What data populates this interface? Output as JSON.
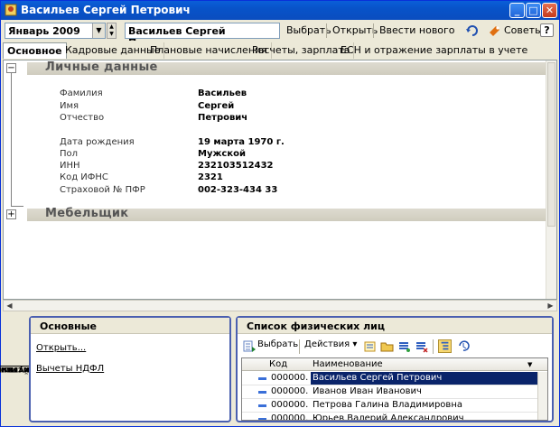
{
  "window": {
    "title": "Васильев Сергей Петрович"
  },
  "toolbar": {
    "period_value": "Январь 2009",
    "person_value": "Васильев Сергей Петрович",
    "select_label": "Выбрать",
    "open_label": "Открыть",
    "enter_new_label": "Ввести нового",
    "tips_label": "Советы",
    "help_label": "?"
  },
  "tabs": [
    {
      "label": "Основное",
      "active": true
    },
    {
      "label": "Кадровые данные"
    },
    {
      "label": "Плановые начисления"
    },
    {
      "label": "Расчеты, зарплата"
    },
    {
      "label": "ЕСН и отражение зарплаты в учете"
    }
  ],
  "personal": {
    "section_title": "Личные данные",
    "expander": "−",
    "fields": [
      {
        "label": "Фамилия",
        "value": "Васильев"
      },
      {
        "label": "Имя",
        "value": "Сергей"
      },
      {
        "label": "Отчество",
        "value": "Петрович"
      },
      {
        "label": "Дата рождения",
        "value": "19 марта 1970 г."
      },
      {
        "label": "Пол",
        "value": "Мужской"
      },
      {
        "label": "ИНН",
        "value": "232103512432"
      },
      {
        "label": "Код ИФНС",
        "value": "2321"
      },
      {
        "label": "Страховой № ПФР",
        "value": "002-323-434 33"
      }
    ]
  },
  "position": {
    "section_title": "Мебельщик",
    "expander": "+"
  },
  "actions": {
    "side_label_line1": "Действия и",
    "side_label_line2": "документы",
    "main_panel": {
      "title": "Основные",
      "links": [
        "Открыть...",
        "Вычеты НДФЛ"
      ]
    },
    "list_panel": {
      "title": "Список физических лиц",
      "select_label": "Выбрать",
      "actions_label": "Действия",
      "columns": [
        "Код",
        "Наименование"
      ],
      "rows": [
        {
          "code": "000000...",
          "name": "Васильев Сергей Петрович",
          "selected": true
        },
        {
          "code": "000000...",
          "name": "Иванов Иван Иванович"
        },
        {
          "code": "000000...",
          "name": "Петрова Галина Владимировна"
        },
        {
          "code": "000000...",
          "name": "Юрьев Валерий Александрович"
        }
      ]
    }
  },
  "colors": {
    "titlebar": "#0a5fd8",
    "panel_border": "#4a5fb0",
    "selection": "#0a246a"
  }
}
